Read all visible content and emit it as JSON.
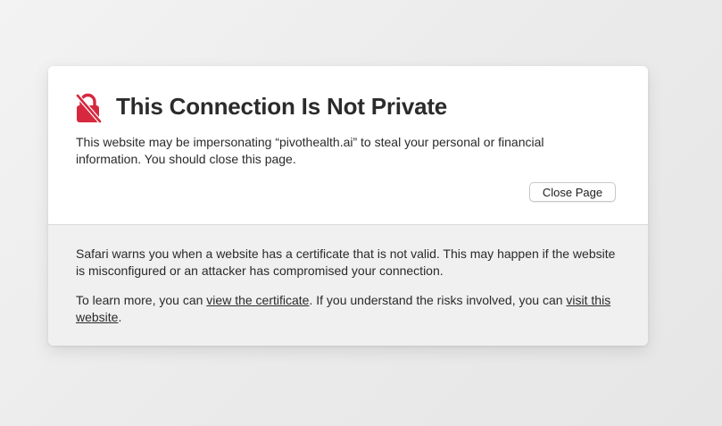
{
  "warning": {
    "title": "This Connection Is Not Private",
    "description": "This website may be impersonating “pivothealth.ai” to steal your personal or financial information. You should close this page.",
    "close_button_label": "Close Page",
    "icon": "lock-slash-icon",
    "icon_color": "#d6293f"
  },
  "details": {
    "paragraph1": "Safari warns you when a website has a certificate that is not valid. This may happen if the website is misconfigured or an attacker has compromised your connection.",
    "paragraph2_prefix": "To learn more, you can ",
    "view_certificate_link": "view the certificate",
    "paragraph2_middle": ". If you understand the risks involved, you can ",
    "visit_website_link": "visit this website",
    "paragraph2_suffix": "."
  }
}
